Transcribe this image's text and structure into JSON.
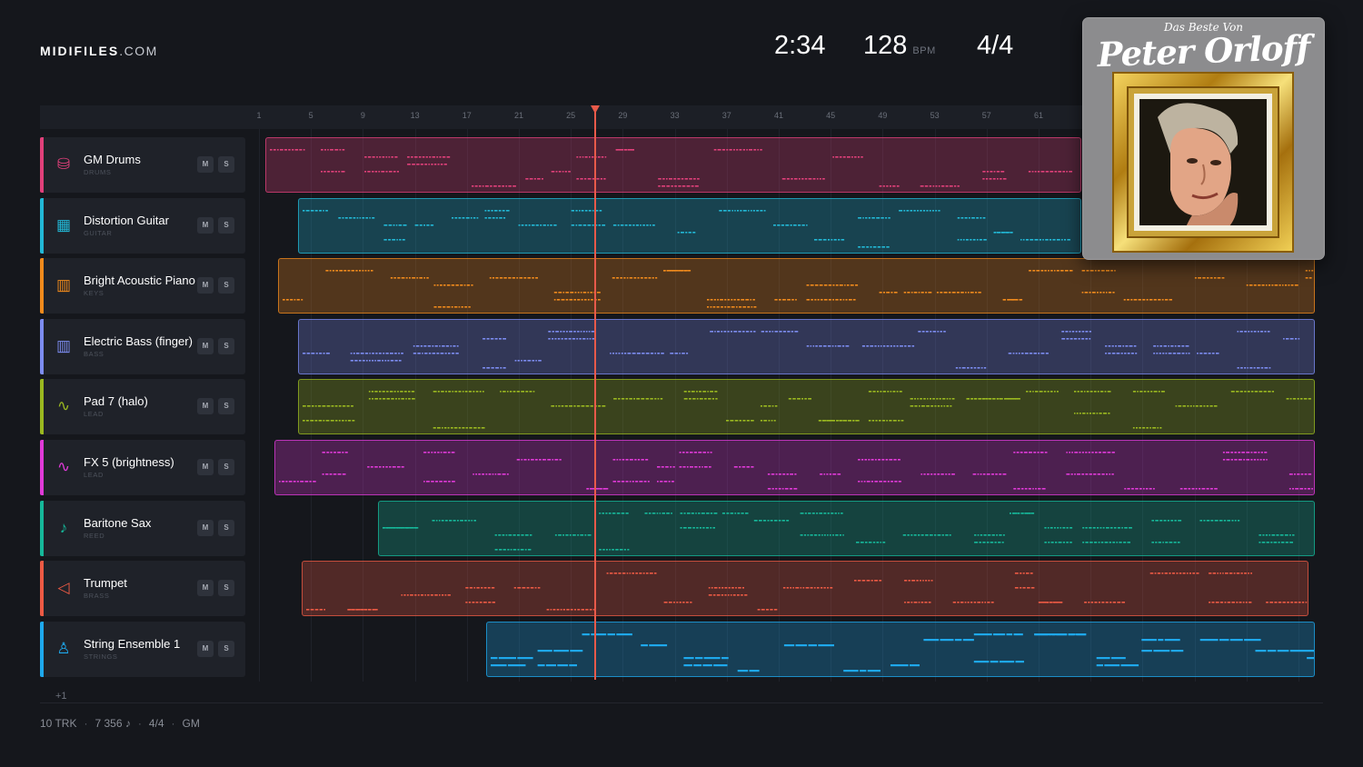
{
  "logo": {
    "bold": "MIDIFILES",
    "light": ".COM"
  },
  "header": {
    "time": "2:34",
    "bpm": "128",
    "bpm_unit": "BPM",
    "signature": "4/4"
  },
  "ruler": {
    "ticks": [
      "1",
      "5",
      "9",
      "13",
      "17",
      "21",
      "25",
      "29",
      "33",
      "37",
      "41",
      "45",
      "49",
      "53",
      "57",
      "61"
    ]
  },
  "playhead": {
    "bar": 26
  },
  "tracks": [
    {
      "name": "GM Drums",
      "category": "DRUMS",
      "icon": "drum-icon",
      "glyph": "⛁",
      "color": "#e0407a",
      "mute": "M",
      "solo": "S"
    },
    {
      "name": "Distortion Guitar",
      "category": "GUITAR",
      "icon": "guitar-icon",
      "glyph": "▦",
      "color": "#22b8d6",
      "mute": "M",
      "solo": "S"
    },
    {
      "name": "Bright Acoustic Piano",
      "category": "KEYS",
      "icon": "piano-icon",
      "glyph": "▥",
      "color": "#f08a1c",
      "mute": "M",
      "solo": "S"
    },
    {
      "name": "Electric Bass (finger)",
      "category": "BASS",
      "icon": "bass-icon",
      "glyph": "▥",
      "color": "#7c8cf0",
      "mute": "M",
      "solo": "S"
    },
    {
      "name": "Pad 7 (halo)",
      "category": "LEAD",
      "icon": "waveform-icon",
      "glyph": "∿",
      "color": "#9ab820",
      "mute": "M",
      "solo": "S"
    },
    {
      "name": "FX 5 (brightness)",
      "category": "LEAD",
      "icon": "waveform-icon",
      "glyph": "∿",
      "color": "#e03ad8",
      "mute": "M",
      "solo": "S"
    },
    {
      "name": "Baritone Sax",
      "category": "REED",
      "icon": "saxophone-icon",
      "glyph": "♪",
      "color": "#16b89a",
      "mute": "M",
      "solo": "S"
    },
    {
      "name": "Trumpet",
      "category": "BRASS",
      "icon": "trumpet-icon",
      "glyph": "◁",
      "color": "#ec5a44",
      "mute": "M",
      "solo": "S"
    },
    {
      "name": "String Ensemble 1",
      "category": "STRINGS",
      "icon": "violin-icon",
      "glyph": "♙",
      "color": "#1ea8ec",
      "mute": "M",
      "solo": "S"
    }
  ],
  "more_tracks": "+1",
  "footer": {
    "tracks": "10 TRK",
    "notes": "7 356 ♪",
    "signature": "4/4",
    "standard": "GM"
  },
  "cover": {
    "subtitle": "Das Beste Von",
    "artist": "Peter Orloff"
  }
}
